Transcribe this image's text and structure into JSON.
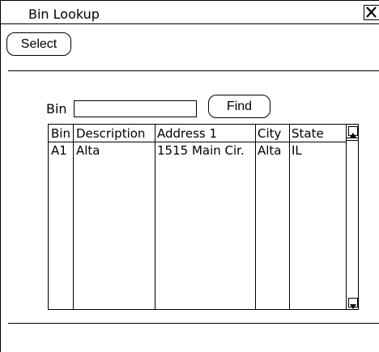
{
  "window": {
    "title": "Bin Lookup"
  },
  "toolbar": {
    "select_label": "Select"
  },
  "search": {
    "bin_label": "Bin",
    "bin_value": "",
    "find_label": "Find"
  },
  "table": {
    "columns": [
      "Bin",
      "Description",
      "Address 1",
      "City",
      "State"
    ],
    "rows": [
      [
        "A1",
        "Alta",
        "1515 Main Cir.",
        "Alta",
        "IL"
      ]
    ]
  }
}
